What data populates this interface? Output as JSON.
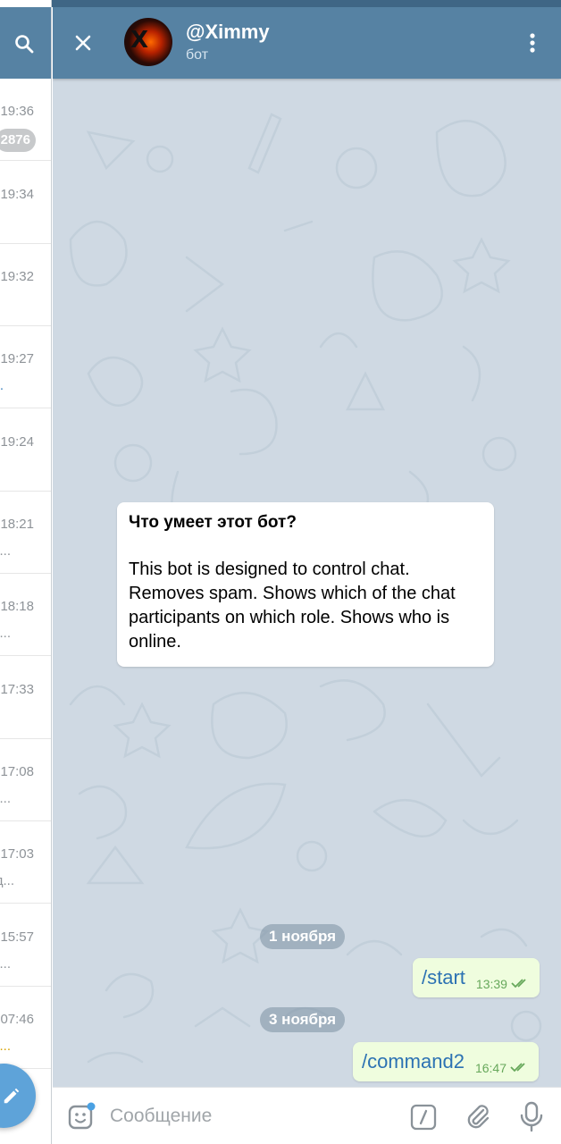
{
  "chat_list": {
    "items": [
      {
        "time": "19:36",
        "preview": "",
        "badge": "2876",
        "preview_style": ""
      },
      {
        "time": "19:34",
        "preview": "",
        "badge": "",
        "preview_style": ""
      },
      {
        "time": "19:32",
        "preview": "",
        "badge": "",
        "preview_style": ""
      },
      {
        "time": "19:27",
        "preview": ".",
        "badge": "",
        "preview_style": "blue"
      },
      {
        "time": "19:24",
        "preview": "",
        "badge": "",
        "preview_style": ""
      },
      {
        "time": "18:21",
        "preview": "...",
        "badge": "",
        "preview_style": ""
      },
      {
        "time": "18:18",
        "preview": "...",
        "badge": "",
        "preview_style": ""
      },
      {
        "time": "17:33",
        "preview": "",
        "badge": "",
        "preview_style": ""
      },
      {
        "time": "17:08",
        "preview": "...",
        "badge": "",
        "preview_style": ""
      },
      {
        "time": "17:03",
        "preview": "д...",
        "badge": "",
        "preview_style": ""
      },
      {
        "time": "15:57",
        "preview": "...",
        "badge": "",
        "preview_style": ""
      },
      {
        "time": "07:46",
        "preview": "...",
        "badge": "",
        "preview_style": "gold"
      }
    ]
  },
  "header": {
    "title": "@Ximmy",
    "subtitle": "бот"
  },
  "bot_info": {
    "title": "Что умеет этот бот?",
    "description": "This bot is designed to control chat. Removes spam. Shows which of the chat participants on which role. Shows who is online."
  },
  "messages": [
    {
      "date": "1 ноября",
      "text": "/start",
      "time": "13:39"
    },
    {
      "date": "3 ноября",
      "text": "/command2",
      "time": "16:47"
    }
  ],
  "composer": {
    "placeholder": "Сообщение"
  },
  "colors": {
    "header": "#5682a3",
    "chat_background": "#cfd9e3",
    "outgoing_bubble": "#effdde",
    "link": "#2c72b3",
    "fab": "#5ea3d9"
  }
}
